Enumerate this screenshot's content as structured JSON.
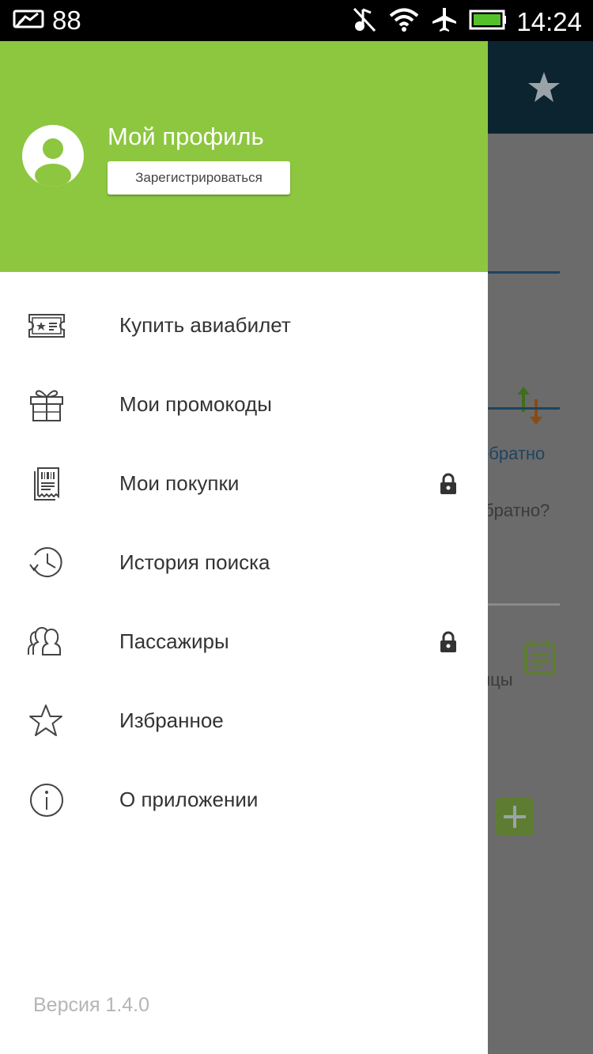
{
  "status_bar": {
    "notification_count": "88",
    "time": "14:24"
  },
  "background": {
    "text_return": "обратно",
    "text_return_question": "братно?",
    "text_partial": "нцы"
  },
  "drawer": {
    "profile_title": "Мой профиль",
    "register_label": "Зарегистрироваться",
    "accent_color": "#8dc63f",
    "items": [
      {
        "label": "Купить авиабилет",
        "icon": "ticket-icon",
        "locked": false
      },
      {
        "label": "Мои промокоды",
        "icon": "gift-icon",
        "locked": false
      },
      {
        "label": "Мои покупки",
        "icon": "receipt-icon",
        "locked": true
      },
      {
        "label": "История поиска",
        "icon": "history-icon",
        "locked": false
      },
      {
        "label": "Пассажиры",
        "icon": "people-icon",
        "locked": true
      },
      {
        "label": "Избранное",
        "icon": "star-icon",
        "locked": false
      },
      {
        "label": "О приложении",
        "icon": "info-icon",
        "locked": false
      }
    ],
    "version": "Версия 1.4.0"
  }
}
